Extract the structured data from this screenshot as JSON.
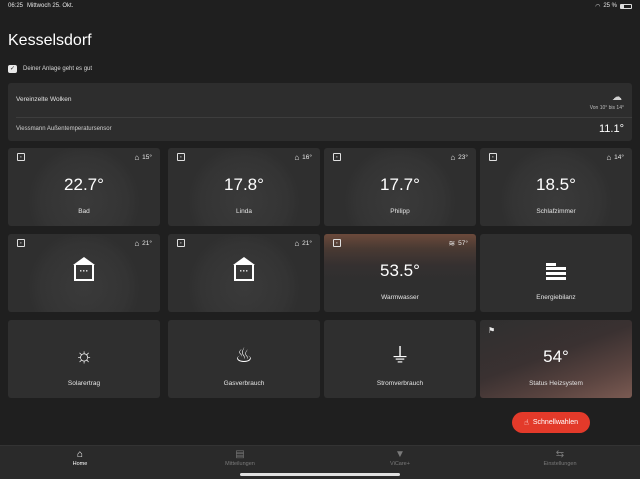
{
  "status_bar": {
    "time": "06:25",
    "date": "Mittwoch 25. Okt.",
    "battery": "25 %",
    "battery_level": 0.25
  },
  "page": {
    "title": "Kesselsdorf",
    "health_text": "Deiner Anlage geht es gut"
  },
  "weather": {
    "condition": "Vereinzelte Wolken",
    "range": "Von 10° bis 14°",
    "sensor_label": "Viessmann Außentemperatursensor",
    "outside_temp": "11.1°",
    "icon": "cloud-moon-icon"
  },
  "rooms": [
    {
      "name": "Bad",
      "temp": "22.7°",
      "target": "15°"
    },
    {
      "name": "Linda",
      "temp": "17.8°",
      "target": "16°"
    },
    {
      "name": "Philipp",
      "temp": "17.7°",
      "target": "23°"
    },
    {
      "name": "Schlafzimmer",
      "temp": "18.5°",
      "target": "14°"
    }
  ],
  "row2": {
    "tile1_target": "21°",
    "tile2_target": "21°",
    "warmwater": {
      "name": "Warmwasser",
      "temp": "53.5°",
      "target": "57°"
    },
    "energy": {
      "name": "Energiebilanz"
    }
  },
  "row3": {
    "solar": {
      "name": "Solarertrag"
    },
    "gas": {
      "name": "Gasverbrauch"
    },
    "power": {
      "name": "Stromverbrauch"
    },
    "status": {
      "name": "Status Heizsystem",
      "value": "54°"
    }
  },
  "quick_button": {
    "label": "Schnellwahlen"
  },
  "tabs": [
    {
      "label": "Home",
      "icon": "home-icon"
    },
    {
      "label": "Mitteilungen",
      "icon": "inbox-icon"
    },
    {
      "label": "ViCare+",
      "icon": "vicare-icon"
    },
    {
      "label": "Einstellungen",
      "icon": "sliders-icon"
    }
  ],
  "colors": {
    "accent": "#e33a2a",
    "background": "#1f1f1f",
    "tile": "#2f2f2f"
  }
}
